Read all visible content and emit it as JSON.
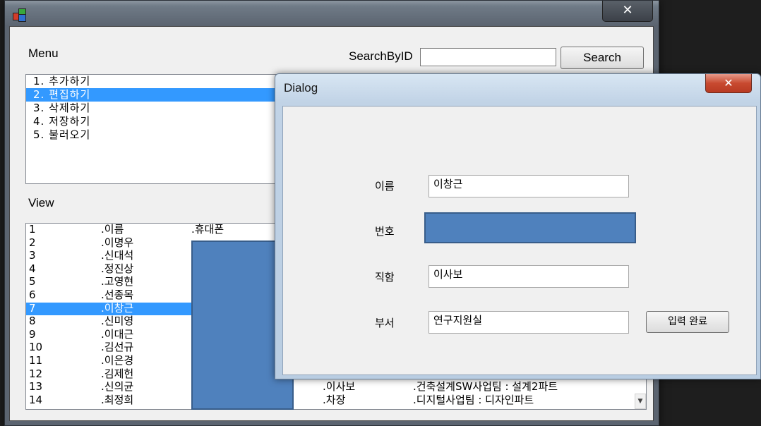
{
  "main_window": {
    "close_label": "✕",
    "menu_label": "Menu",
    "search_label": "SearchByID",
    "search_value": "",
    "search_button": "Search",
    "view_label": "View",
    "menu_items": [
      "1. 추가하기",
      "2. 편집하기",
      "3. 삭제하기",
      "4. 저장하기",
      "5. 불러오기"
    ],
    "view_rows": [
      {
        "id": "1",
        "name": ".이름",
        "phone": ".휴대폰",
        "position": "",
        "dept": ""
      },
      {
        "id": "2",
        "name": ".이명우",
        "phone": "",
        "position": "",
        "dept": ""
      },
      {
        "id": "3",
        "name": ".신대석",
        "phone": "",
        "position": "",
        "dept": ""
      },
      {
        "id": "4",
        "name": ".정진상",
        "phone": "",
        "position": "",
        "dept": ""
      },
      {
        "id": "5",
        "name": ".고영현",
        "phone": "",
        "position": "",
        "dept": ""
      },
      {
        "id": "6",
        "name": ".선종목",
        "phone": "",
        "position": "",
        "dept": ""
      },
      {
        "id": "7",
        "name": ".이창근",
        "phone": "",
        "position": "",
        "dept": ""
      },
      {
        "id": "8",
        "name": ".신미영",
        "phone": "",
        "position": "",
        "dept": ""
      },
      {
        "id": "9",
        "name": ".이대근",
        "phone": "",
        "position": "",
        "dept": ""
      },
      {
        "id": "10",
        "name": ".김선규",
        "phone": "",
        "position": "",
        "dept": ""
      },
      {
        "id": "11",
        "name": ".이은경",
        "phone": "",
        "position": "",
        "dept": ""
      },
      {
        "id": "12",
        "name": ".김제헌",
        "phone": "",
        "position": "",
        "dept": ""
      },
      {
        "id": "13",
        "name": ".신의균",
        "phone": "",
        "position": ".이사보",
        "dept": ".건축설계SW사업팀 : 설계2파트"
      },
      {
        "id": "14",
        "name": ".최정희",
        "phone": "",
        "position": ".차장",
        "dept": ".디지털사업팀 : 디자인파트"
      }
    ],
    "scroll_down_glyph": "▼"
  },
  "dialog": {
    "title": "Dialog",
    "close_label": "✕",
    "name_label": "이름",
    "name_value": "이창근",
    "number_label": "번호",
    "job_label": "직함",
    "job_value": "이사보",
    "dept_label": "부서",
    "dept_value": "연구지원실",
    "submit_label": "입력 완료"
  },
  "colors": {
    "selection": "#3399ff",
    "redaction": "#4f81bd"
  }
}
